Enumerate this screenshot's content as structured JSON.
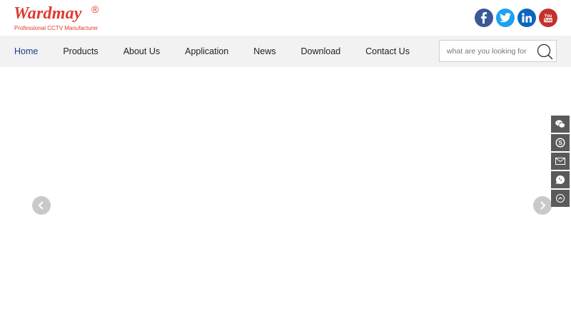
{
  "brand": {
    "name": "Wardmay",
    "registered": "®",
    "tagline": "Professional CCTV Manufacturer",
    "color": "#e03a2e"
  },
  "social": [
    {
      "name": "facebook",
      "icon": "facebook-icon",
      "color": "#3b5998"
    },
    {
      "name": "twitter",
      "icon": "twitter-icon",
      "color": "#1da1f2"
    },
    {
      "name": "linkedin",
      "icon": "linkedin-icon",
      "color": "#0a66c2"
    },
    {
      "name": "youtube",
      "icon": "youtube-icon",
      "color": "#c4302b"
    }
  ],
  "nav": {
    "items": [
      {
        "label": "Home",
        "active": true
      },
      {
        "label": "Products"
      },
      {
        "label": "About Us"
      },
      {
        "label": "Application"
      },
      {
        "label": "News"
      },
      {
        "label": "Download"
      },
      {
        "label": "Contact Us"
      }
    ],
    "active_color": "#1a3f8a",
    "background": "#f2f2f2"
  },
  "search": {
    "placeholder": "what are you looking for",
    "value": "",
    "icon": "search-icon"
  },
  "slider": {
    "prev_icon": "chevron-left-icon",
    "next_icon": "chevron-right-icon"
  },
  "side_toolbar": [
    {
      "icon": "wechat-icon"
    },
    {
      "icon": "skype-icon"
    },
    {
      "icon": "email-icon"
    },
    {
      "icon": "whatsapp-icon"
    },
    {
      "icon": "back-to-top-icon"
    }
  ]
}
